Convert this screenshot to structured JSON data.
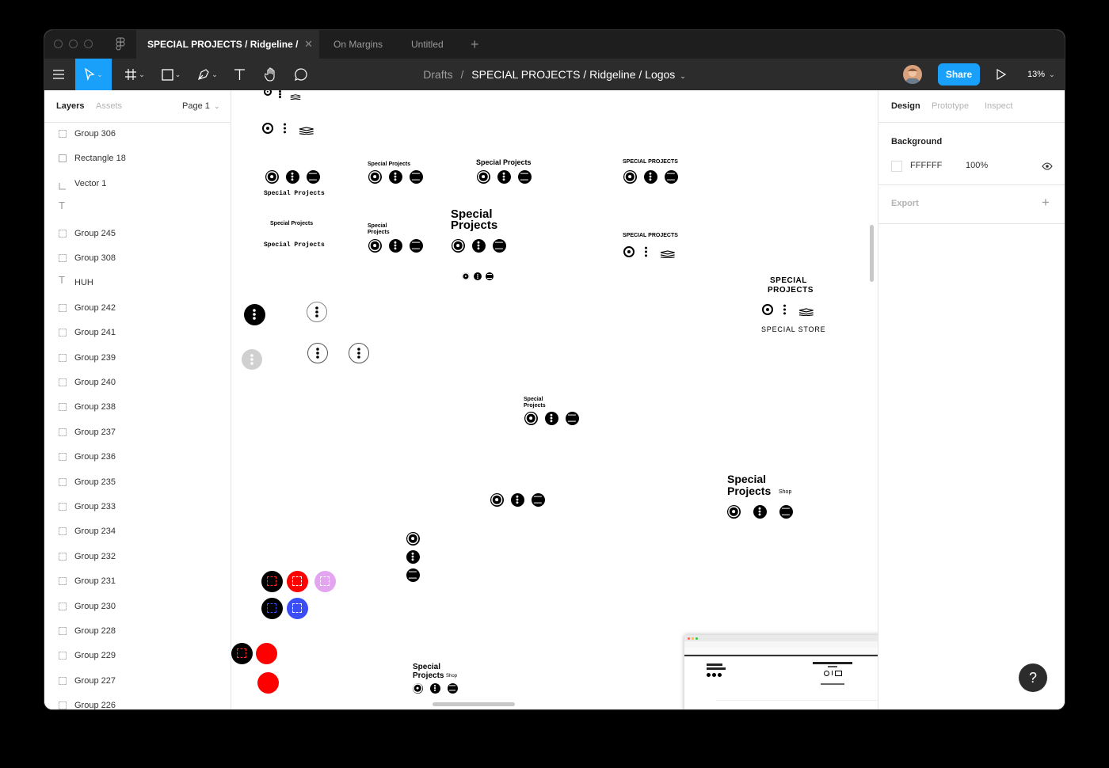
{
  "window": {
    "tabs": [
      {
        "label": "SPECIAL PROJECTS / Ridgeline / Lo...",
        "active": true
      },
      {
        "label": "On Margins",
        "active": false
      },
      {
        "label": "Untitled",
        "active": false
      }
    ],
    "add_tab": "+"
  },
  "toolbar": {
    "breadcrumb_root": "Drafts",
    "breadcrumb_sep": "/",
    "breadcrumb_file": "SPECIAL PROJECTS / Ridgeline / Logos",
    "share_label": "Share",
    "zoom": "13%",
    "tools": [
      "menu-icon",
      "move-icon",
      "frame-icon",
      "shape-icon",
      "pen-icon",
      "text-icon",
      "hand-icon",
      "comment-icon",
      "play-icon"
    ]
  },
  "left_panel": {
    "tab_layers": "Layers",
    "tab_assets": "Assets",
    "page": "Page 1",
    "layers": [
      {
        "name": "Group 306",
        "icon": "group"
      },
      {
        "name": "Rectangle 18",
        "icon": "rect"
      },
      {
        "name": "Vector 1",
        "icon": "vector"
      },
      {
        "name": "",
        "icon": "text"
      },
      {
        "name": "Group 245",
        "icon": "group"
      },
      {
        "name": "Group 308",
        "icon": "group"
      },
      {
        "name": "HUH",
        "icon": "text"
      },
      {
        "name": "Group 242",
        "icon": "group"
      },
      {
        "name": "Group 241",
        "icon": "group"
      },
      {
        "name": "Group 239",
        "icon": "group"
      },
      {
        "name": "Group 240",
        "icon": "group"
      },
      {
        "name": "Group 238",
        "icon": "group"
      },
      {
        "name": "Group 237",
        "icon": "group"
      },
      {
        "name": "Group 236",
        "icon": "group"
      },
      {
        "name": "Group 235",
        "icon": "group"
      },
      {
        "name": "Group 233",
        "icon": "group"
      },
      {
        "name": "Group 234",
        "icon": "group"
      },
      {
        "name": "Group 232",
        "icon": "group"
      },
      {
        "name": "Group 231",
        "icon": "group"
      },
      {
        "name": "Group 230",
        "icon": "group"
      },
      {
        "name": "Group 228",
        "icon": "group"
      },
      {
        "name": "Group 229",
        "icon": "group"
      },
      {
        "name": "Group 227",
        "icon": "group"
      },
      {
        "name": "Group 226",
        "icon": "group"
      }
    ]
  },
  "right_panel": {
    "tab_design": "Design",
    "tab_prototype": "Prototype",
    "tab_inspect": "Inspect",
    "background_title": "Background",
    "bg_hex": "FFFFFF",
    "bg_opacity": "100%",
    "export_title": "Export",
    "export_add": "+"
  },
  "canvas": {
    "labels": {
      "sp_mono_1": "Special Projects",
      "sp_small_1": "Special Projects",
      "sp_medium_1": "Special Projects",
      "sp_caps_1": "SPECIAL PROJECTS",
      "sp_small_2": "Special Projects",
      "sp_mono_2": "Special Projects",
      "sp_stack_small_1": "Special",
      "sp_stack_small_2": "Projects",
      "sp_big_1": "Special",
      "sp_big_2": "Projects",
      "sp_caps_2": "SPECIAL PROJECTS",
      "special_caps_a": "SPECIAL",
      "special_caps_b": "PROJECTS",
      "special_store": "SPECIAL STORE",
      "sp_mid_1": "Special",
      "sp_mid_2": "Projects",
      "shop_big_1": "Special",
      "shop_big_2": "Projects",
      "shop_word": "Shop",
      "shop_small_1": "Special",
      "shop_small_2": "Projects",
      "shop_small_word": "Shop"
    },
    "colors": {
      "black": "#000000",
      "red": "#ff0000",
      "blue": "#3b4ef5",
      "lilac": "#e3a5ef",
      "grey": "#d0d0d0"
    }
  },
  "help_label": "?"
}
